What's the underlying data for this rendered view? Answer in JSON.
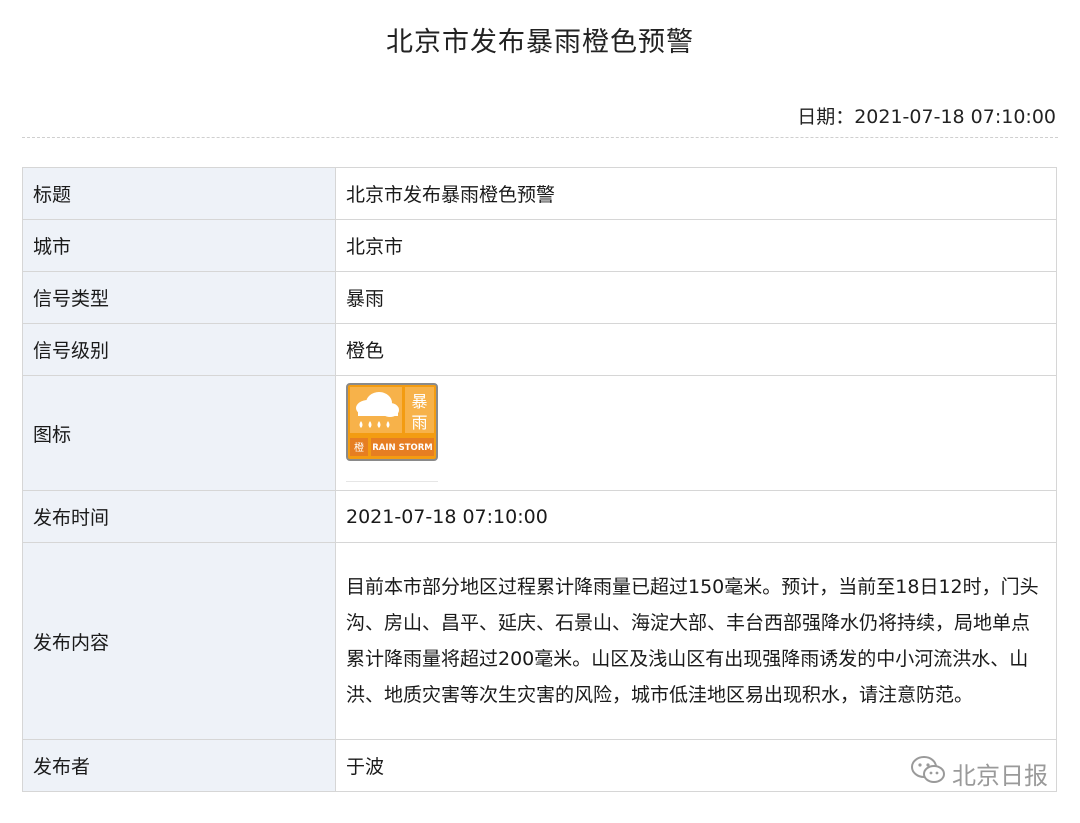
{
  "page": {
    "title": "北京市发布暴雨橙色预警",
    "date": "日期：2021-07-18 07:10:00"
  },
  "table": {
    "rows": [
      {
        "label": "标题",
        "value": "北京市发布暴雨橙色预警"
      },
      {
        "label": "城市",
        "value": "北京市"
      },
      {
        "label": "信号类型",
        "value": "暴雨"
      },
      {
        "label": "信号级别",
        "value": "橙色"
      },
      {
        "label": "图标",
        "value": ""
      },
      {
        "label": "发布时间",
        "value": "2021-07-18 07:10:00"
      },
      {
        "label": "发布内容",
        "value": "目前本市部分地区过程累计降雨量已超过150毫米。预计，当前至18日12时，门头沟、房山、昌平、延庆、石景山、海淀大部、丰台西部强降水仍将持续，局地单点累计降雨量将超过200毫米。山区及浅山区有出现强降雨诱发的中小河流洪水、山洪、地质灾害等次生灾害的风险，城市低洼地区易出现积水，请注意防范。"
      },
      {
        "label": "发布者",
        "value": "于波"
      }
    ]
  },
  "warning_icon": {
    "name": "rainstorm-orange-warning-icon",
    "glyph_top": "暴",
    "glyph_bottom": "雨",
    "level_char": "橙",
    "english": "RAIN STORM",
    "color": "#f39c12"
  },
  "watermark": {
    "text": "北京日报",
    "icon": "wechat-icon"
  }
}
